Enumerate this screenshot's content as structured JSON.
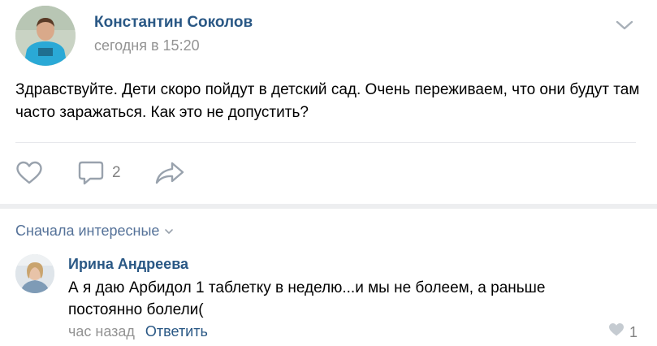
{
  "post": {
    "author": "Константин Соколов",
    "time": "сегодня в 15:20",
    "text": "Здравствуйте. Дети скоро пойдут в детский сад. Очень переживаем, что они будут там часто заражаться. Как это не допустить?",
    "comments_count": "2",
    "icons": {
      "menu": "chevron-down-icon",
      "like": "heart-outline-icon",
      "comment": "speech-bubble-icon",
      "share": "share-arrow-icon"
    }
  },
  "comments_section": {
    "sort_label": "Сначала интересные",
    "sort_icon": "chevron-down-icon",
    "items": [
      {
        "author": "Ирина Андреева",
        "text": "А я даю Арбидол 1 таблетку в неделю...и мы не болеем, а раньше постоянно болели(",
        "time": "час назад",
        "reply_label": "Ответить",
        "likes": "1",
        "like_icon": "heart-filled-icon"
      }
    ]
  },
  "colors": {
    "link": "#2a5885",
    "secondary_text": "#939393",
    "icon": "#99a2ad",
    "divider": "#e7e8ec",
    "band": "#edeef0"
  }
}
